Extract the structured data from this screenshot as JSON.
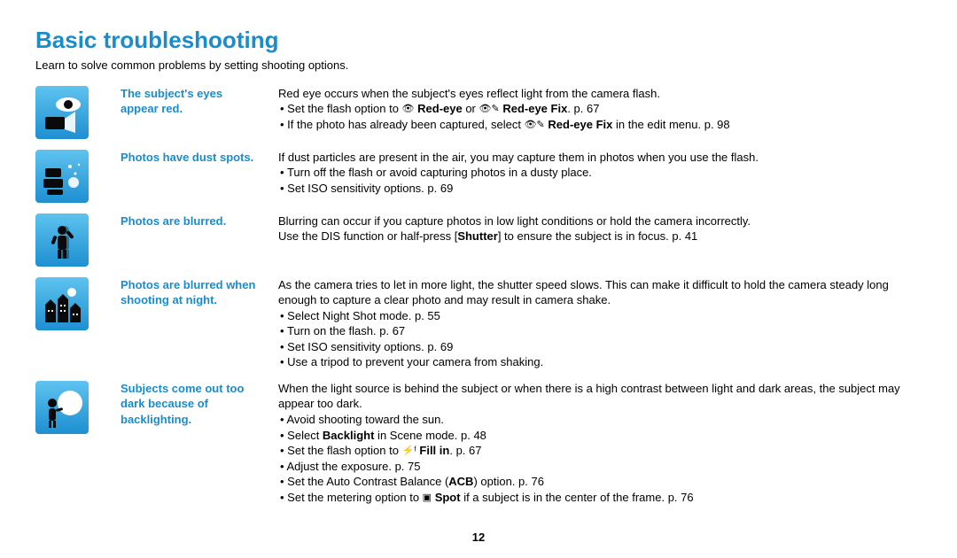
{
  "title": "Basic troubleshooting",
  "intro": "Learn to solve common problems by setting shooting options.",
  "page_number": "12",
  "items": [
    {
      "label": "The subject's eyes appear red.",
      "icon": "eye-flash-icon",
      "lead": "Red eye occurs when the subject's eyes reflect light from the camera flash.",
      "bullets_html": [
        "Set the flash option to <span class='ico-inline'>👁</span> <span class='bold'>Red-eye</span> or <span class='ico-inline'>👁✎</span> <span class='bold'>Red-eye Fix</span>. p. 67",
        "If the photo has already been captured, select <span class='ico-inline'>👁✎</span> <span class='bold'>Red-eye Fix</span> in the edit menu. p. 98"
      ]
    },
    {
      "label": "Photos have dust spots.",
      "icon": "dust-icon",
      "lead": "If dust particles are present in the air, you may capture them in photos when you use the flash.",
      "bullets_html": [
        "Turn off the flash or avoid capturing photos in a dusty place.",
        "Set ISO sensitivity options. p. 69"
      ]
    },
    {
      "label": "Photos are blurred.",
      "icon": "blur-person-icon",
      "lead_html": "Blurring can occur if you capture photos in low light conditions or hold the camera incorrectly.<br>Use the DIS function or half-press [<span class='bold'>Shutter</span>] to ensure the subject is in focus. p. 41",
      "bullets_html": []
    },
    {
      "label": "Photos are blurred when shooting at night.",
      "icon": "night-city-icon",
      "lead": "As the camera tries to let in more light, the shutter speed slows. This can make it difficult to hold the camera steady long enough to capture a clear photo and may result in camera shake.",
      "bullets_html": [
        "Select Night Shot mode. p. 55",
        "Turn on the flash. p. 67",
        "Set ISO sensitivity options. p. 69",
        "Use a tripod to prevent your camera from shaking."
      ]
    },
    {
      "label": "Subjects come out too dark because of backlighting.",
      "icon": "backlight-icon",
      "lead": "When the light source is behind the subject or when there is a high contrast between light and dark areas, the subject may appear too dark.",
      "bullets_html": [
        "Avoid shooting toward the sun.",
        "Select <span class='bold'>Backlight</span> in Scene mode. p. 48",
        "Set the flash option to <span class='ico-inline'>⚡ᶠ</span> <span class='bold'>Fill in</span>. p. 67",
        "Adjust the exposure. p. 75",
        "Set the Auto Contrast Balance (<span class='bold'>ACB</span>) option. p. 76",
        "Set the metering option to <span class='ico-inline'>▣</span> <span class='bold'>Spot</span> if a subject is in the center of the frame. p. 76"
      ]
    }
  ]
}
